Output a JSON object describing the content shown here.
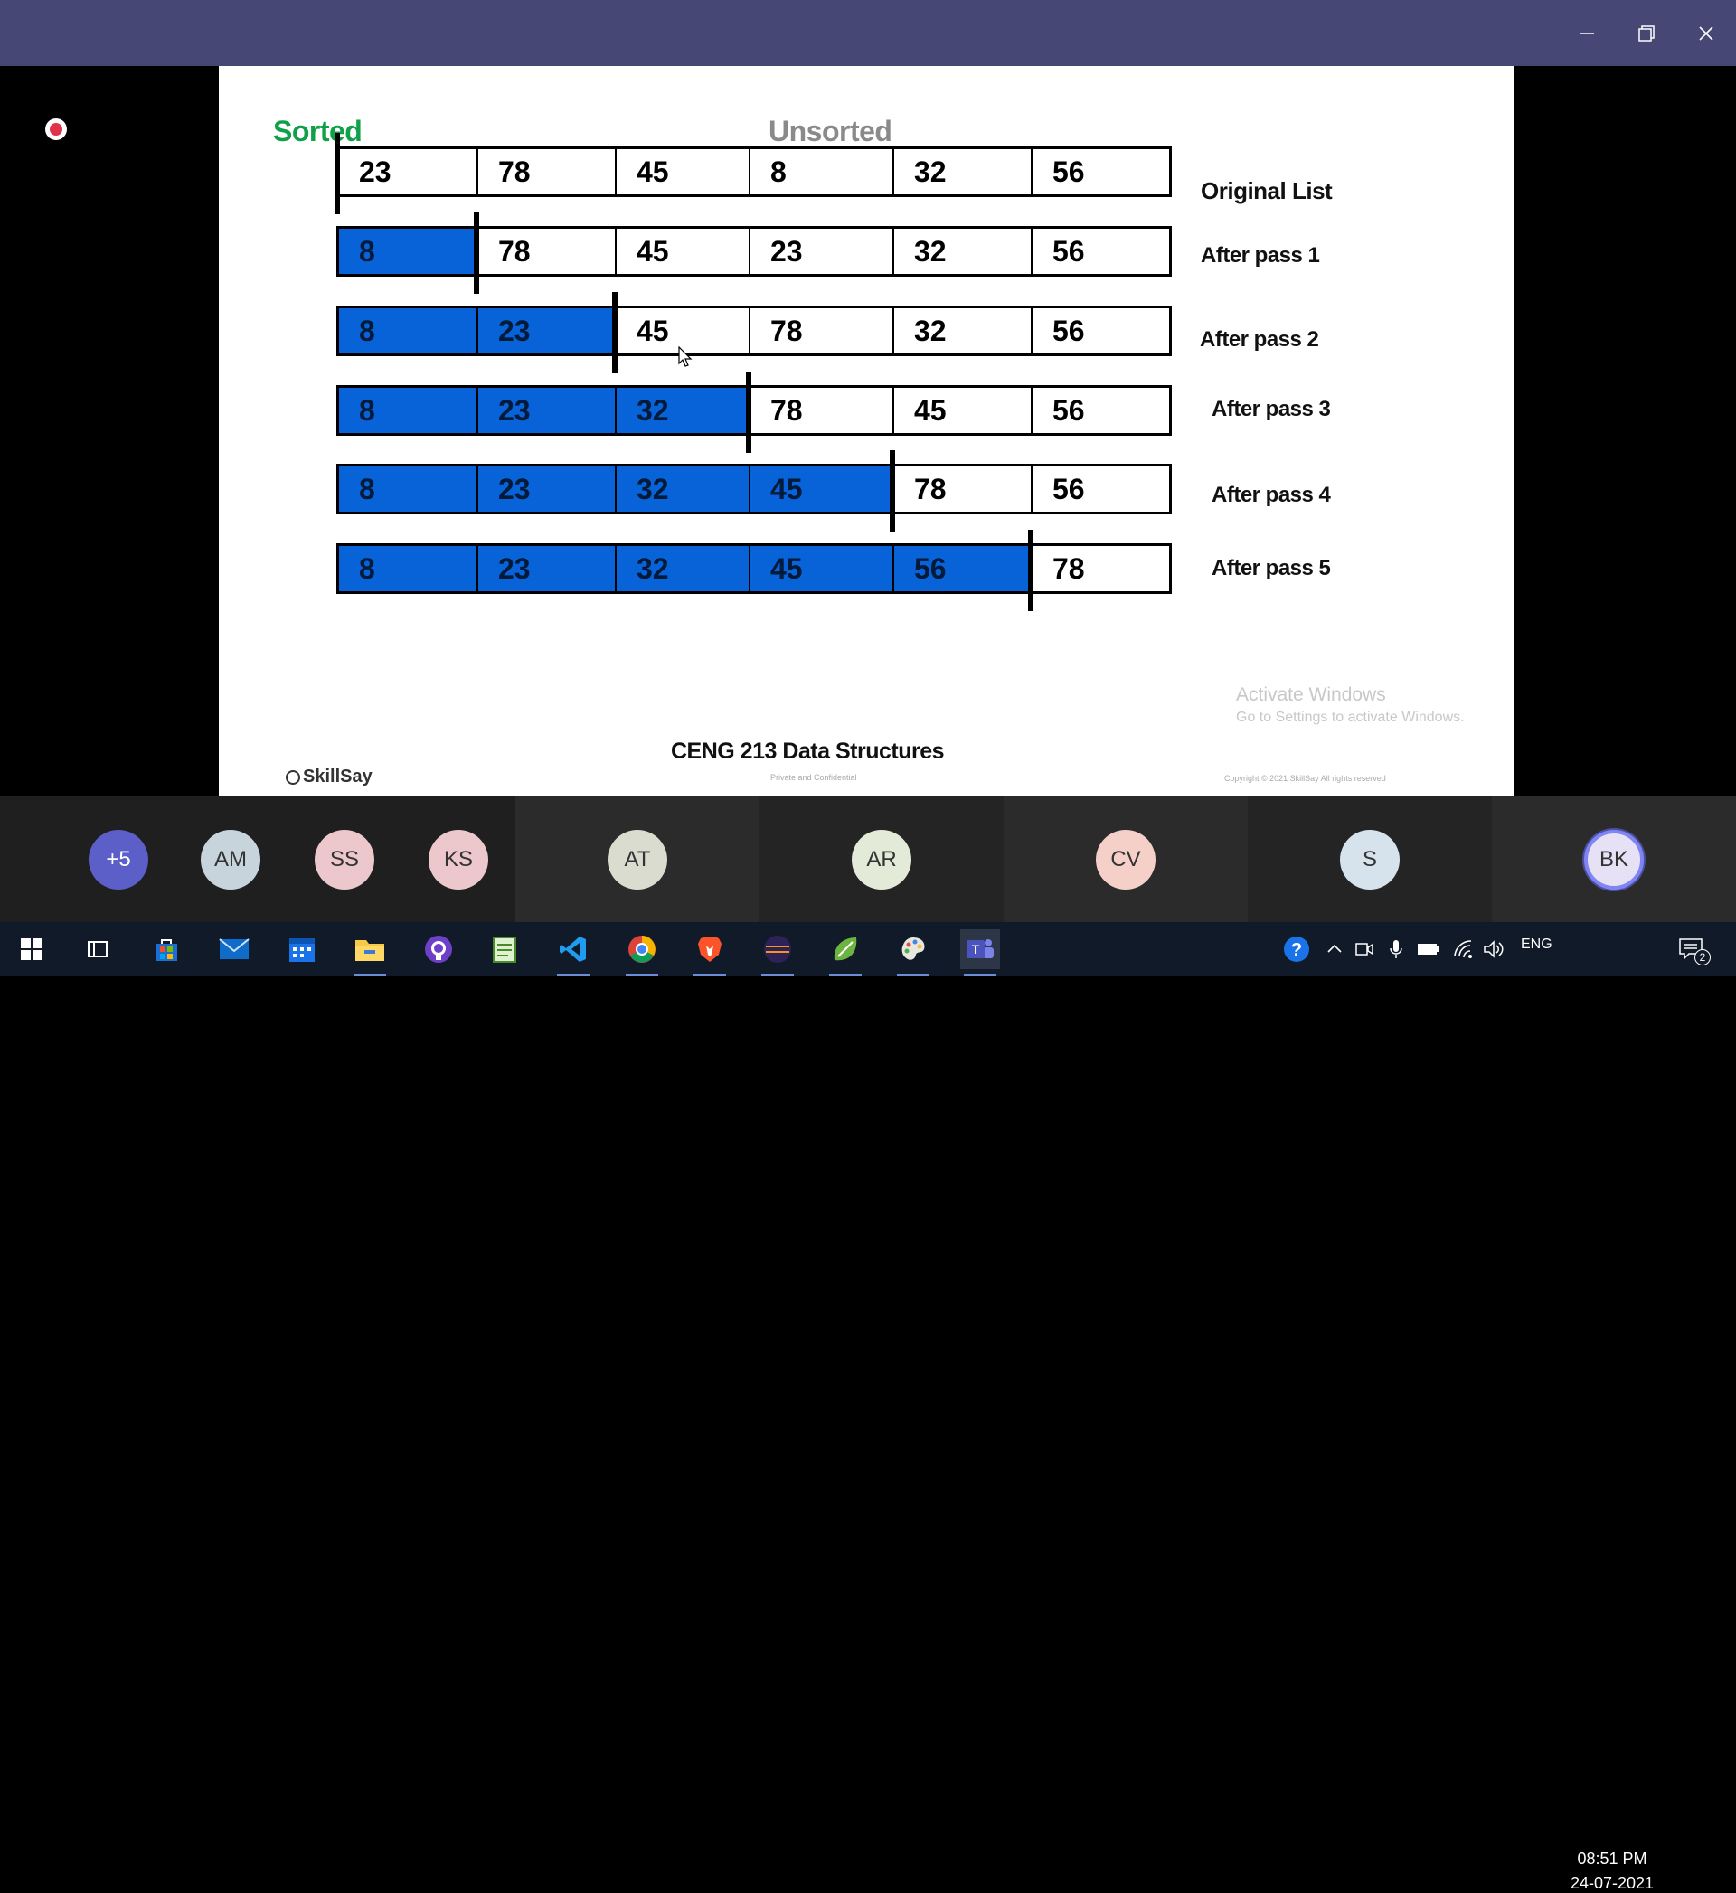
{
  "window": {
    "minimize_icon": "minimize-icon",
    "maximize_icon": "restore-icon",
    "close_icon": "close-icon"
  },
  "slide": {
    "header_sorted": "Sorted",
    "header_unsorted": "Unsorted",
    "rows": [
      {
        "label": "Original List",
        "values": [
          "23",
          "78",
          "45",
          "8",
          "32",
          "56"
        ],
        "sorted_count": 0
      },
      {
        "label": "After pass 1",
        "values": [
          "8",
          "78",
          "45",
          "23",
          "32",
          "56"
        ],
        "sorted_count": 1
      },
      {
        "label": "After pass 2",
        "values": [
          "8",
          "23",
          "45",
          "78",
          "32",
          "56"
        ],
        "sorted_count": 2
      },
      {
        "label": "After pass 3",
        "values": [
          "8",
          "23",
          "32",
          "78",
          "45",
          "56"
        ],
        "sorted_count": 3
      },
      {
        "label": "After pass 4",
        "values": [
          "8",
          "23",
          "32",
          "45",
          "78",
          "56"
        ],
        "sorted_count": 4
      },
      {
        "label": "After pass 5",
        "values": [
          "8",
          "23",
          "32",
          "45",
          "56",
          "78"
        ],
        "sorted_count": 5
      }
    ],
    "footer_title": "CENG 213 Data Structures",
    "footer_private": "Private and Confidential",
    "footer_copyright": "Copyright © 2021 SkillSay All rights reserved",
    "brand": "SkillSay",
    "colors": {
      "sorted_fill": "#0863d8",
      "sorted_header": "#10a04a",
      "unsorted_header": "#8a8a8a"
    }
  },
  "watermark": {
    "title": "Activate Windows",
    "subtitle": "Go to Settings to activate Windows."
  },
  "participants": {
    "overflow": "+5",
    "list": [
      {
        "initials": "AM",
        "color": "#c8d4dc"
      },
      {
        "initials": "SS",
        "color": "#ecc7cc"
      },
      {
        "initials": "KS",
        "color": "#ecc7cc"
      },
      {
        "initials": "AT",
        "color": "#dadcd0"
      },
      {
        "initials": "AR",
        "color": "#e3ead8"
      },
      {
        "initials": "CV",
        "color": "#f5d0c8"
      },
      {
        "initials": "S",
        "color": "#d6e3ec"
      },
      {
        "initials": "BK",
        "color": "#e6e1f5"
      }
    ]
  },
  "taskbar": {
    "apps": [
      "start-icon",
      "task-view-icon",
      "store-icon",
      "mail-icon",
      "calendar-icon",
      "file-explorer-icon",
      "github-icon",
      "notepad-icon",
      "vscode-icon",
      "chrome-icon",
      "brave-icon",
      "eclipse-icon",
      "spring-icon",
      "paint-icon",
      "teams-icon"
    ],
    "tray": {
      "language": "ENG",
      "time": "08:51 PM",
      "date": "24-07-2021",
      "notifications": "2"
    }
  }
}
